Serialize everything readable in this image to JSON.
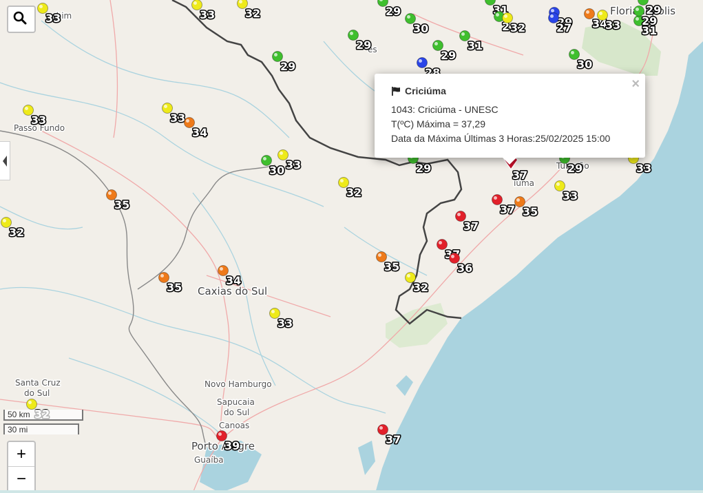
{
  "colors": {
    "land": "#f2efe9",
    "sea": "#aad3df",
    "green": "#3fbf2e",
    "yellow": "#eeea1a",
    "orange": "#ee7a1a",
    "red": "#e2202a",
    "blue": "#2a45e8"
  },
  "places": [
    {
      "id": "chim",
      "label": "chim"
    },
    {
      "id": "passo-fundo",
      "label": "Passo Fundo"
    },
    {
      "id": "caxias",
      "label": "Caxias do Sul"
    },
    {
      "id": "santa-cruz-1",
      "label": "Santa Cruz"
    },
    {
      "id": "santa-cruz-2",
      "label": "do Sul"
    },
    {
      "id": "novo-hamburgo",
      "label": "Novo Hamburgo"
    },
    {
      "id": "sapucaia-1",
      "label": "Sapucaia"
    },
    {
      "id": "sapucaia-2",
      "label": "do Sul"
    },
    {
      "id": "canoas",
      "label": "Canoas"
    },
    {
      "id": "porto-alegre",
      "label": "Porto Alegre"
    },
    {
      "id": "guaiba",
      "label": "Guaíba"
    },
    {
      "id": "tubarao",
      "label": "Tubarão"
    },
    {
      "id": "florianopolis",
      "label": "Florianópolis"
    },
    {
      "id": "lajes",
      "label": "es"
    },
    {
      "id": "criciuma-short",
      "label": "iúma"
    }
  ],
  "stations": [
    {
      "id": "s1",
      "color": "yellow",
      "label": "33"
    },
    {
      "id": "s2",
      "color": "yellow",
      "label": "33"
    },
    {
      "id": "s3",
      "color": "yellow",
      "label": "32"
    },
    {
      "id": "s4",
      "color": "green",
      "label": "29"
    },
    {
      "id": "s5",
      "color": "green",
      "label": "30"
    },
    {
      "id": "s6",
      "color": "green",
      "label": "31"
    },
    {
      "id": "s7",
      "color": "green",
      "label": "2"
    },
    {
      "id": "s8",
      "color": "yellow",
      "label": "32"
    },
    {
      "id": "s9",
      "color": "blue",
      "label": "29"
    },
    {
      "id": "s10",
      "color": "blue",
      "label": "27"
    },
    {
      "id": "s11",
      "color": "orange",
      "label": "34"
    },
    {
      "id": "s12",
      "color": "yellow",
      "label": "33"
    },
    {
      "id": "s13",
      "color": "green",
      "label": "31"
    },
    {
      "id": "s14",
      "color": "green",
      "label": "29"
    },
    {
      "id": "s15",
      "color": "green",
      "label": "29"
    },
    {
      "id": "s16",
      "color": "green",
      "label": "29"
    },
    {
      "id": "s17",
      "color": "green",
      "label": "31"
    },
    {
      "id": "s18",
      "color": "green",
      "label": "29"
    },
    {
      "id": "s19",
      "color": "blue",
      "label": "28"
    },
    {
      "id": "s20",
      "color": "green",
      "label": "30"
    },
    {
      "id": "s21",
      "color": "yellow",
      "label": "33"
    },
    {
      "id": "s22",
      "color": "yellow",
      "label": "33"
    },
    {
      "id": "s23",
      "color": "orange",
      "label": "34"
    },
    {
      "id": "s24",
      "color": "green",
      "label": "30"
    },
    {
      "id": "s25",
      "color": "yellow",
      "label": "33"
    },
    {
      "id": "s26",
      "color": "yellow",
      "label": "32"
    },
    {
      "id": "s27",
      "color": "orange",
      "label": "35"
    },
    {
      "id": "s28",
      "color": "yellow",
      "label": "32"
    },
    {
      "id": "s29",
      "color": "red",
      "label": "37"
    },
    {
      "id": "s30",
      "color": "red",
      "label": "37"
    },
    {
      "id": "s31",
      "color": "orange",
      "label": "35"
    },
    {
      "id": "s32",
      "color": "yellow",
      "label": "33"
    },
    {
      "id": "s33",
      "color": "red",
      "label": "37"
    },
    {
      "id": "s34",
      "color": "red",
      "label": "36"
    },
    {
      "id": "s35",
      "color": "orange",
      "label": "35"
    },
    {
      "id": "s36",
      "color": "yellow",
      "label": "32"
    },
    {
      "id": "s37",
      "color": "orange",
      "label": "35"
    },
    {
      "id": "s38",
      "color": "orange",
      "label": "34"
    },
    {
      "id": "s39",
      "color": "yellow",
      "label": "33"
    },
    {
      "id": "s40",
      "color": "yellow",
      "label": "32"
    },
    {
      "id": "s41",
      "color": "red",
      "label": "39"
    },
    {
      "id": "s42",
      "color": "red",
      "label": "37"
    },
    {
      "id": "s43",
      "color": "green",
      "label": "29"
    },
    {
      "id": "s44",
      "color": "green",
      "label": "29"
    },
    {
      "id": "s45",
      "color": "yellow",
      "label": "33"
    },
    {
      "id": "s46",
      "color": "green",
      "label": "29"
    }
  ],
  "popup": {
    "title": "Criciúma",
    "line1": "1043: Criciúma - UNESC",
    "line2": "T(ºC) Máxima = 37,29",
    "line3": "Data da Máxima Últimas 3 Horas:25/02/2025 15:00",
    "close": "×"
  },
  "controls": {
    "zoom_in": "+",
    "zoom_out": "−",
    "search_icon": "search-icon"
  },
  "scale": {
    "km": "50 km",
    "mi": "30 mi"
  }
}
